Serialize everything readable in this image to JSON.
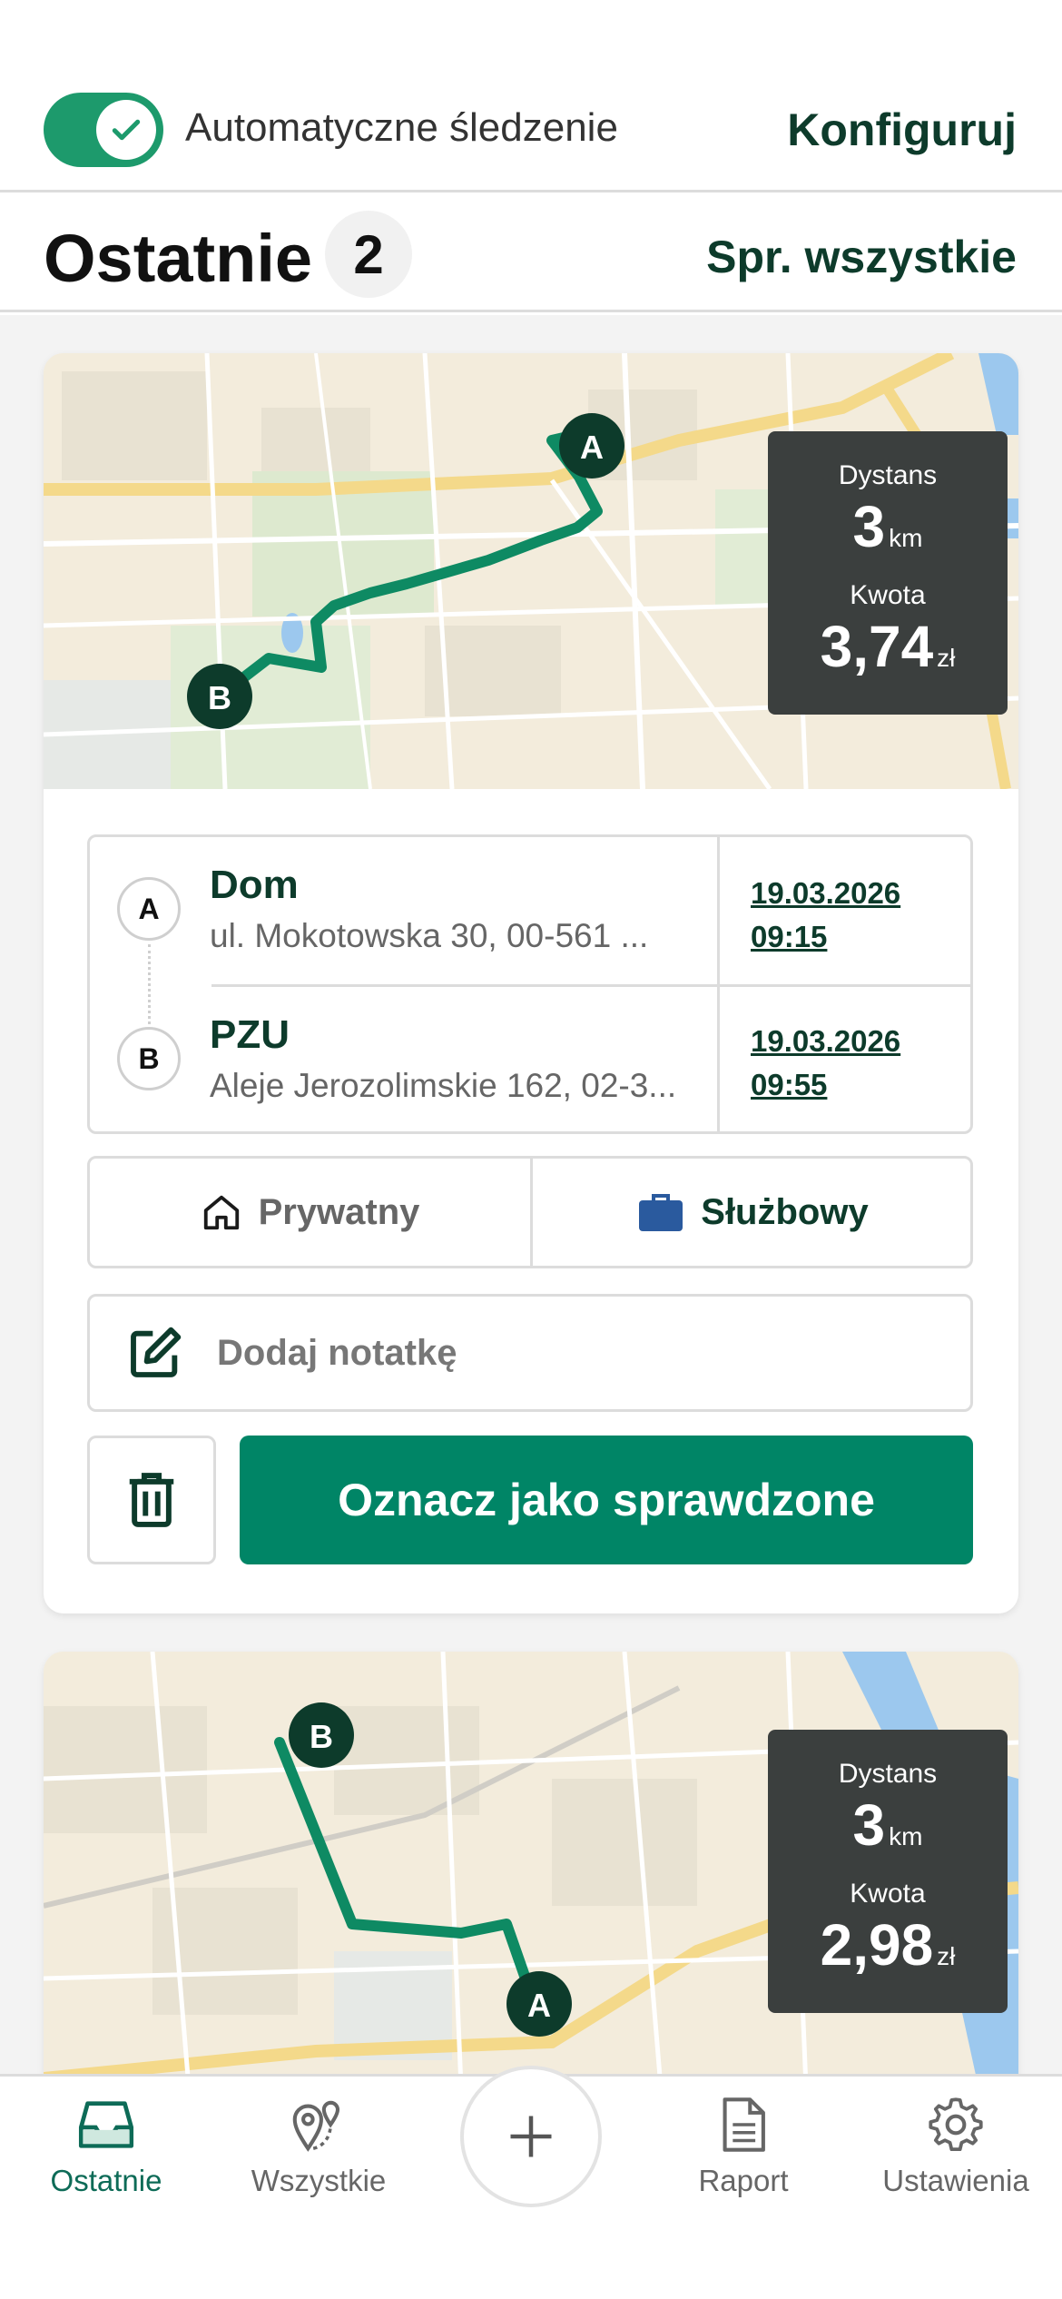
{
  "tracking": {
    "label": "Automatyczne śledzenie",
    "enabled": true,
    "configure_label": "Konfiguruj"
  },
  "recent": {
    "title": "Ostatnie",
    "count": "2",
    "see_all_label": "Spr. wszystkie"
  },
  "trips": [
    {
      "distance_label": "Dystans",
      "distance_value": "3",
      "distance_unit": "km",
      "amount_label": "Kwota",
      "amount_value": "3,74",
      "amount_unit": "zł",
      "start": {
        "marker": "A",
        "name": "Dom",
        "address": "ul. Mokotowska 30, 00-561 ...",
        "date": "19.03.2026",
        "time": "09:15"
      },
      "end": {
        "marker": "B",
        "name": "PZU",
        "address": "Aleje Jerozolimskie 162, 02-3...",
        "date": "19.03.2026",
        "time": "09:55"
      },
      "category_private": "Prywatny",
      "category_business": "Służbowy",
      "note_placeholder": "Dodaj notatkę",
      "mark_label": "Oznacz jako sprawdzone"
    },
    {
      "distance_label": "Dystans",
      "distance_value": "3",
      "distance_unit": "km",
      "amount_label": "Kwota",
      "amount_value": "2,98",
      "amount_unit": "zł",
      "start_marker": "A",
      "end_marker": "B"
    }
  ],
  "nav": {
    "recent": "Ostatnie",
    "all": "Wszystkie",
    "report": "Raport",
    "settings": "Ustawienia"
  },
  "colors": {
    "brand_green": "#008566",
    "route_green": "#0e8a63",
    "dark_green_text": "#0d3b2b",
    "business_blue": "#2a5a9e"
  }
}
